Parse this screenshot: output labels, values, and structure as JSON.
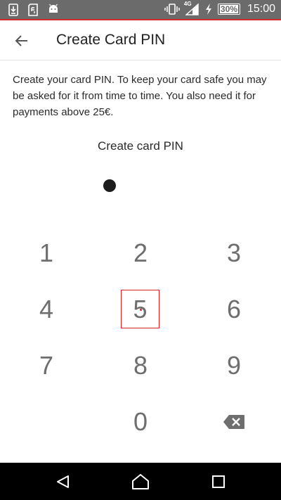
{
  "status_bar": {
    "battery": "30%",
    "network": "4G",
    "time": "15:00",
    "left_icons": [
      "download-icon",
      "sim-icon",
      "android-icon"
    ],
    "right_icons": [
      "vibrate-icon",
      "signal-icon",
      "charging-icon"
    ]
  },
  "app_bar": {
    "title": "Create Card PIN",
    "back_icon": "arrow-back-icon"
  },
  "description": "Create your card PIN. To keep your card safe you may be asked for it from time to time. You also need it for payments above 25€.",
  "pin": {
    "label": "Create card PIN",
    "entered_count": 1
  },
  "keypad": {
    "keys": [
      "1",
      "2",
      "3",
      "4",
      "5",
      "6",
      "7",
      "8",
      "9",
      "0"
    ],
    "pressed_key": "5",
    "backspace_icon": "backspace-icon"
  },
  "nav_bar": {
    "buttons": [
      "back-triangle-icon",
      "home-icon",
      "recents-icon"
    ]
  },
  "colors": {
    "accent": "#d42a2a",
    "status_bar": "#6b6b6b",
    "key_text": "#6e6e6e"
  }
}
